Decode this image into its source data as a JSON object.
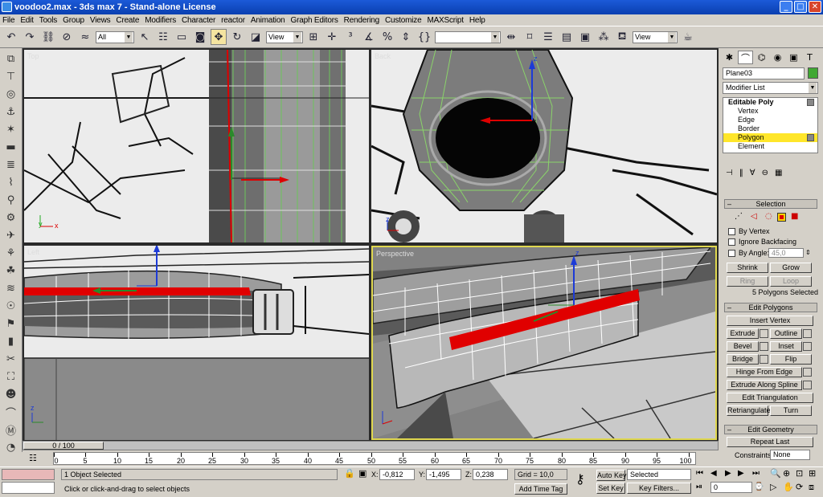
{
  "window": {
    "title": "voodoo2.max  - 3ds max 7  - Stand-alone License",
    "min": "_",
    "max": "□",
    "close": "✕"
  },
  "menu": [
    "File",
    "Edit",
    "Tools",
    "Group",
    "Views",
    "Create",
    "Modifiers",
    "Character",
    "reactor",
    "Animation",
    "Graph Editors",
    "Rendering",
    "Customize",
    "MAXScript",
    "Help"
  ],
  "toolbar": {
    "selection_filter": "All",
    "ref_coord": "View",
    "named_sel": "",
    "render_type": "View"
  },
  "viewports": {
    "top": "Top",
    "back": "Back",
    "left": "Left",
    "persp": "Perspective"
  },
  "command_panel": {
    "object_name": "Plane03",
    "object_color": "#40a832",
    "modifier_list": "Modifier List",
    "stack": {
      "root": "Editable Poly",
      "items": [
        "Vertex",
        "Edge",
        "Border",
        "Polygon",
        "Element"
      ],
      "selected": "Polygon"
    },
    "selection": {
      "title": "Selection",
      "by_vertex": "By Vertex",
      "ignore_backfacing": "Ignore Backfacing",
      "by_angle": "By Angle:",
      "angle_value": "45,0",
      "shrink": "Shrink",
      "grow": "Grow",
      "ring": "Ring",
      "loop": "Loop",
      "status": "5 Polygons Selected"
    },
    "edit_polygons": {
      "title": "Edit Polygons",
      "insert_vertex": "Insert Vertex",
      "extrude": "Extrude",
      "outline": "Outline",
      "bevel": "Bevel",
      "inset": "Inset",
      "bridge": "Bridge",
      "flip": "Flip",
      "hinge": "Hinge From Edge",
      "extrude_spline": "Extrude Along Spline",
      "edit_tri": "Edit Triangulation",
      "retriangulate": "Retriangulate",
      "turn": "Turn"
    },
    "edit_geometry": {
      "title": "Edit Geometry",
      "repeat_last": "Repeat Last",
      "constraints_label": "Constraints:",
      "constraints_value": "None"
    }
  },
  "timeline": {
    "slider": "0 / 100",
    "ticks": [
      "0",
      "5",
      "10",
      "15",
      "20",
      "25",
      "30",
      "35",
      "40",
      "45",
      "50",
      "55",
      "60",
      "65",
      "70",
      "75",
      "80",
      "85",
      "90",
      "95",
      "100"
    ]
  },
  "status": {
    "selected": "1 Object Selected",
    "prompt": "Click or click-and-drag to select objects",
    "x_label": "X:",
    "x": "-0,812",
    "y_label": "Y:",
    "y": "-1,495",
    "z_label": "Z:",
    "z": "0,238",
    "grid": "Grid = 10,0",
    "add_time_tag": "Add Time Tag",
    "auto_key": "Auto Key",
    "set_key": "Set Key",
    "key_mode": "Selected",
    "key_filters": "Key Filters...",
    "frame": "0"
  }
}
